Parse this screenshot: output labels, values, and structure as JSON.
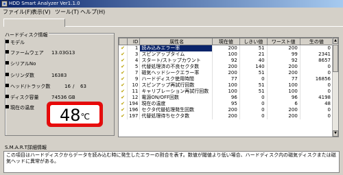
{
  "window": {
    "title": "HDD Smart Analyzer Ver1.1.0"
  },
  "menu": [
    {
      "label": "ファイル(F)"
    },
    {
      "label": "表示(V)"
    },
    {
      "label": "ツール(T)"
    },
    {
      "label": "ヘルプ(H)"
    }
  ],
  "info": {
    "group_title": "ハードディスク情報",
    "model_label": "モデル",
    "firmware_label": "ファームウェア",
    "firmware_value": "13.03G13",
    "serial_label": "シリアルNo",
    "cylinder_label": "シリンダ数",
    "cylinder_value": "16383",
    "heads_label": "ヘッド/トラック数",
    "heads_value": "16",
    "sectors_value": "63",
    "capacity_label": "ディスク容量",
    "capacity_value": "74536 GB",
    "temp_label": "現在の温度",
    "temp_value": "48",
    "temp_unit": "℃"
  },
  "table": {
    "headers": [
      "",
      "ID",
      "属性名",
      "現在値",
      "しきい値",
      "ワースト値",
      "生の値"
    ],
    "rows": [
      {
        "id": "1",
        "name": "読み込みエラー率",
        "cur": "200",
        "thr": "51",
        "worst": "200",
        "raw": "0",
        "selected": true
      },
      {
        "id": "3",
        "name": "スピンアップタイム",
        "cur": "100",
        "thr": "21",
        "worst": "99",
        "raw": "2341"
      },
      {
        "id": "4",
        "name": "スタート/ストップカウント",
        "cur": "92",
        "thr": "40",
        "worst": "92",
        "raw": "8657"
      },
      {
        "id": "5",
        "name": "代替処理済の不良セクタ数",
        "cur": "200",
        "thr": "140",
        "worst": "200",
        "raw": "0"
      },
      {
        "id": "7",
        "name": "磁気ヘッドシークエラー率",
        "cur": "200",
        "thr": "51",
        "worst": "200",
        "raw": "0"
      },
      {
        "id": "9",
        "name": "ハードディスク使用時間",
        "cur": "77",
        "thr": "0",
        "worst": "77",
        "raw": "16856"
      },
      {
        "id": "10",
        "name": "スピンアップ再試行回数",
        "cur": "100",
        "thr": "51",
        "worst": "100",
        "raw": "0"
      },
      {
        "id": "11",
        "name": "キャリブレーション再試行回数",
        "cur": "100",
        "thr": "51",
        "worst": "100",
        "raw": "0"
      },
      {
        "id": "12",
        "name": "電源ON/OFF回数",
        "cur": "96",
        "thr": "0",
        "worst": "96",
        "raw": "4198"
      },
      {
        "id": "194",
        "name": "現在の温度",
        "cur": "95",
        "thr": "0",
        "worst": "6",
        "raw": "48"
      },
      {
        "id": "196",
        "name": "セクタ代替処理発生回数",
        "cur": "200",
        "thr": "0",
        "worst": "200",
        "raw": "0"
      },
      {
        "id": "197",
        "name": "代替処理待ちセクタ数",
        "cur": "200",
        "thr": "0",
        "worst": "200",
        "raw": "0"
      }
    ]
  },
  "detail": {
    "title": "S.M.A.R.T詳細情報",
    "text": "この項目はハードディスクからデータを読み込む時に発生したエラーの割合を表す。数値が閾値より低い場合、ハードディスク内の磁気ディスクまたは磁気ヘッドに異常がある。"
  },
  "colors": {
    "selection": "#0a246a",
    "temp_border": "#e01010",
    "check": "#b8a000"
  }
}
